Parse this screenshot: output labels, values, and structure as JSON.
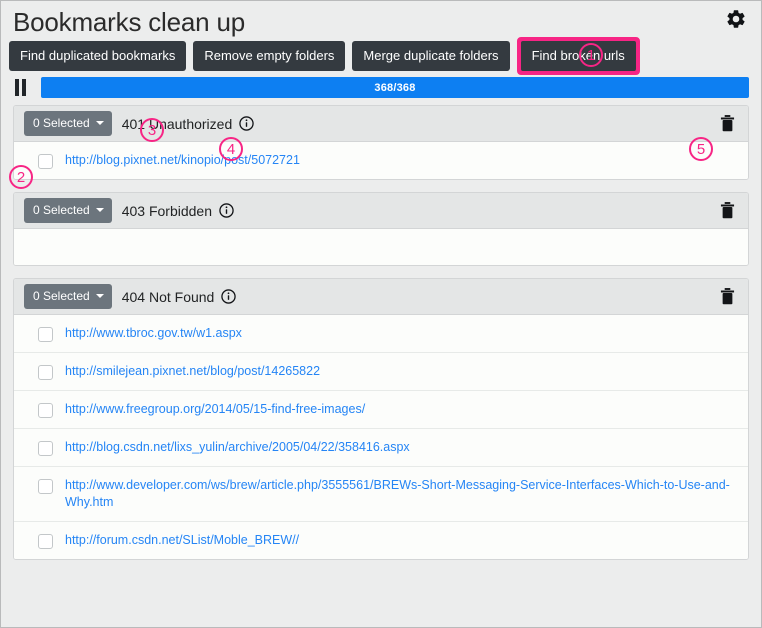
{
  "header": {
    "title": "Bookmarks clean up",
    "settings_icon": "gear-icon"
  },
  "toolbar": {
    "buttons": [
      {
        "label": "Find duplicated bookmarks",
        "highlighted": false
      },
      {
        "label": "Remove empty folders",
        "highlighted": false
      },
      {
        "label": "Merge duplicate folders",
        "highlighted": false
      },
      {
        "label": "Find broken urls",
        "highlighted": true
      }
    ]
  },
  "progress": {
    "pause_icon": "pause-icon",
    "label": "368/368",
    "current": 368,
    "total": 368,
    "percent": 100,
    "fill_color": "#0d7ff2"
  },
  "sections": [
    {
      "select_label": "0 Selected",
      "title": "401 Unauthorized",
      "info_icon": "info-icon",
      "delete_icon": "trash-icon",
      "urls": [
        "http://blog.pixnet.net/kinopio/post/5072721"
      ]
    },
    {
      "select_label": "0 Selected",
      "title": "403 Forbidden",
      "info_icon": "info-icon",
      "delete_icon": "trash-icon",
      "urls": []
    },
    {
      "select_label": "0 Selected",
      "title": "404 Not Found",
      "info_icon": "info-icon",
      "delete_icon": "trash-icon",
      "urls": [
        "http://www.tbroc.gov.tw/w1.aspx",
        "http://smilejean.pixnet.net/blog/post/14265822",
        "http://www.freegroup.org/2014/05/15-find-free-images/",
        "http://blog.csdn.net/lixs_yulin/archive/2005/04/22/358416.aspx",
        "http://www.developer.com/ws/brew/article.php/3555561/BREWs-Short-Messaging-Service-Interfaces-Which-to-Use-and-Why.htm",
        "http://forum.csdn.net/SList/Moble_BREW//"
      ]
    }
  ],
  "annotations": [
    {
      "id": 1,
      "label": "①"
    },
    {
      "id": 2,
      "label": "②"
    },
    {
      "id": 3,
      "label": "③"
    },
    {
      "id": 4,
      "label": "④"
    },
    {
      "id": 5,
      "label": "⑤"
    }
  ],
  "colors": {
    "accent_pink": "#f72585",
    "button_dark": "#343a40",
    "select_gray": "#6c757d",
    "link_blue": "#2585f5",
    "progress_blue": "#0d7ff2",
    "page_bg": "#eceded"
  }
}
